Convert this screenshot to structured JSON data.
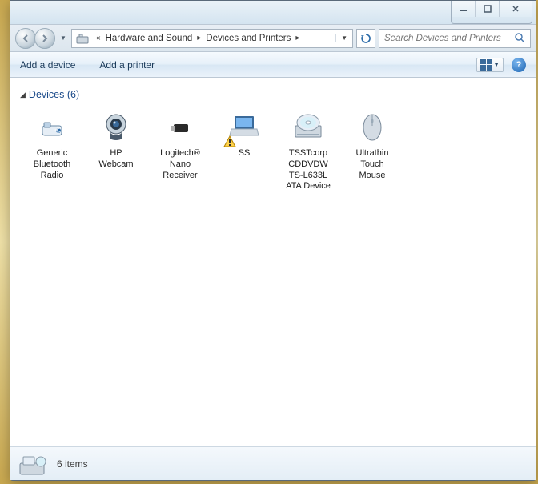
{
  "breadcrumbs": {
    "chevrons": "«",
    "seg1": "Hardware and Sound",
    "seg2": "Devices and Printers"
  },
  "search": {
    "placeholder": "Search Devices and Printers"
  },
  "toolbar": {
    "add_device": "Add a device",
    "add_printer": "Add a printer"
  },
  "group": {
    "title": "Devices (6)"
  },
  "devices": [
    {
      "label1": "Generic",
      "label2": "Bluetooth",
      "label3": "Radio"
    },
    {
      "label1": "HP",
      "label2": "Webcam",
      "label3": ""
    },
    {
      "label1": "Logitech®",
      "label2": "Nano",
      "label3": "Receiver"
    },
    {
      "label1": "SS",
      "label2": "",
      "label3": ""
    },
    {
      "label1": "TSSTcorp",
      "label2": "CDDVDW",
      "label3": "TS-L633L",
      "label4": "ATA Device"
    },
    {
      "label1": "Ultrathin",
      "label2": "Touch",
      "label3": "Mouse"
    }
  ],
  "status": {
    "text": "6 items"
  }
}
